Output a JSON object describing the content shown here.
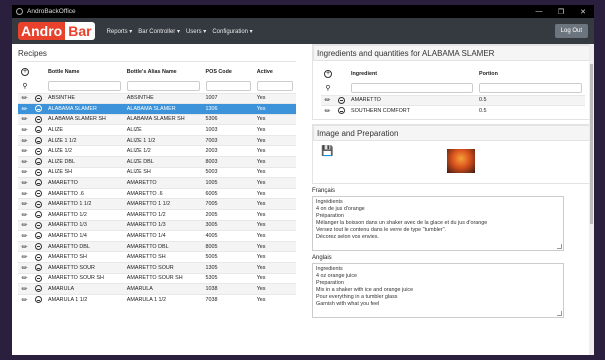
{
  "window": {
    "title": "AndroBackOffice",
    "min": "—",
    "max": "❐",
    "close": "✕"
  },
  "navbar": {
    "logo_left": "Andro",
    "logo_right": "Bar",
    "menu": [
      "Reports ▾",
      "Bar Controller ▾",
      "Users ▾",
      "Configuration ▾"
    ],
    "logout": "Log Out"
  },
  "recipes": {
    "title": "Recipes",
    "columns": [
      "Bottle Name",
      "Bottle's Alias Name",
      "POS Code",
      "Active"
    ],
    "rows": [
      [
        "ABSINTHE",
        "ABSINTHE",
        "1007",
        "Yes"
      ],
      [
        "ALABAMA SLAMER",
        "ALABAMA SLAMER",
        "1306",
        "Yes"
      ],
      [
        "ALABAMA SLAMER SH",
        "ALABAMA SLAMER SH",
        "5306",
        "Yes"
      ],
      [
        "ALIZE",
        "ALIZE",
        "1003",
        "Yes"
      ],
      [
        "ALIZE 1 1/2",
        "ALIZE 1 1/2",
        "7003",
        "Yes"
      ],
      [
        "ALIZE 1/2",
        "ALIZE 1/2",
        "2003",
        "Yes"
      ],
      [
        "ALIZE DBL",
        "ALIZE DBL",
        "8003",
        "Yes"
      ],
      [
        "ALIZE SH",
        "ALIZE SH",
        "5003",
        "Yes"
      ],
      [
        "AMARETTO",
        "AMARETTO",
        "1005",
        "Yes"
      ],
      [
        "AMARETTO .6",
        "AMARETTO .6",
        "6005",
        "Yes"
      ],
      [
        "AMARETTO 1 1/2",
        "AMARETTO 1 1/2",
        "7005",
        "Yes"
      ],
      [
        "AMARETTO 1/2",
        "AMARETTO 1/2",
        "2005",
        "Yes"
      ],
      [
        "AMARETTO 1/3",
        "AMARETTO 1/3",
        "3005",
        "Yes"
      ],
      [
        "AMARETTO 1/4",
        "AMARETTO 1/4",
        "4005",
        "Yes"
      ],
      [
        "AMARETTO DBL",
        "AMARETTO DBL",
        "8005",
        "Yes"
      ],
      [
        "AMARETTO SH",
        "AMARETTO SH",
        "5005",
        "Yes"
      ],
      [
        "AMARETTO SOUR",
        "AMARETTO SOUR",
        "1305",
        "Yes"
      ],
      [
        "AMARETTO SOUR SH",
        "AMARETTO SOUR SH",
        "5305",
        "Yes"
      ],
      [
        "AMARULA",
        "AMARULA",
        "1038",
        "Yes"
      ],
      [
        "AMARULA 1 1/2",
        "AMARULA 1 1/2",
        "7038",
        "Yes"
      ]
    ]
  },
  "ingredients": {
    "title": "Ingredients and quantities for ALABAMA SLAMER",
    "columns": [
      "Ingredient",
      "Portion"
    ],
    "rows": [
      [
        "AMARETTO",
        "0.5"
      ],
      [
        "SOUTHERN COMFORT",
        "0.5"
      ]
    ]
  },
  "image_prep": {
    "title": "Image and Preparation",
    "french_label": "Français",
    "french_text": "Ingrédients\n4 on de jus d'orange\nPréparation\nMélanger la boisson dans un shaker avec de la glace et du jus d'orange\nVersez tout le contenu dans le verre de type \"tumbler\".\nDécorez selon vos envies.",
    "english_label": "Anglais",
    "english_text": "Ingredients\n4 oz orange juice\nPreparation\nMix in a shaker with ice and orange juice\nPour everything in a tumbler glass\nGarnish with what you feel"
  }
}
